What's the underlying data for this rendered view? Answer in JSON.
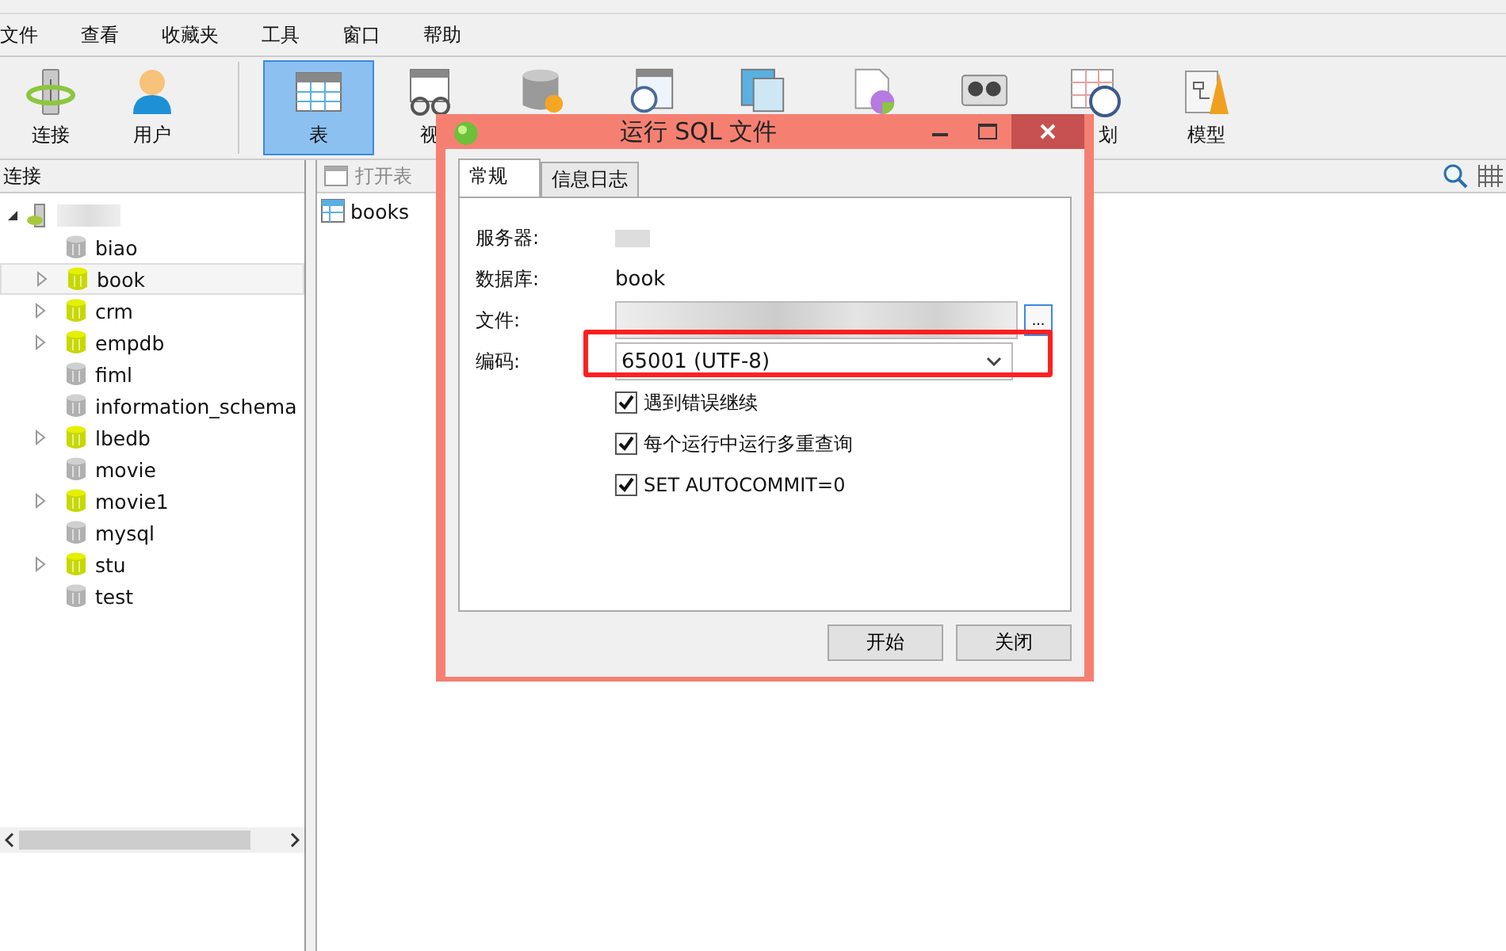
{
  "menu": [
    "文件",
    "查看",
    "收藏夹",
    "工具",
    "窗口",
    "帮助"
  ],
  "toolbar": {
    "left": [
      {
        "kind": "connect",
        "label": "连接",
        "selected": false
      },
      {
        "kind": "user",
        "label": "用户",
        "selected": false
      }
    ],
    "right": [
      {
        "kind": "table",
        "label": "表",
        "selected": true
      },
      {
        "kind": "view",
        "label": "视",
        "selected": false
      },
      {
        "kind": "function",
        "selected": false
      },
      {
        "kind": "event",
        "selected": false
      },
      {
        "kind": "query",
        "selected": false
      },
      {
        "kind": "report",
        "selected": false
      },
      {
        "kind": "backup",
        "selected": false
      },
      {
        "kind": "schedule",
        "label": "划",
        "selected": false
      },
      {
        "kind": "model",
        "label": "模型",
        "selected": false
      }
    ]
  },
  "connections": {
    "header": "连接",
    "root": {
      "expanded": true,
      "children": [
        {
          "name": "biao",
          "open": false,
          "expandable": false,
          "selected": false
        },
        {
          "name": "book",
          "open": true,
          "expandable": true,
          "selected": true
        },
        {
          "name": "crm",
          "open": true,
          "expandable": true,
          "selected": false
        },
        {
          "name": "empdb",
          "open": true,
          "expandable": true,
          "selected": false
        },
        {
          "name": "fiml",
          "open": false,
          "expandable": false,
          "selected": false
        },
        {
          "name": "information_schema",
          "open": false,
          "expandable": false,
          "selected": false
        },
        {
          "name": "lbedb",
          "open": true,
          "expandable": true,
          "selected": false
        },
        {
          "name": "movie",
          "open": false,
          "expandable": false,
          "selected": false
        },
        {
          "name": "movie1",
          "open": true,
          "expandable": true,
          "selected": false
        },
        {
          "name": "mysql",
          "open": false,
          "expandable": false,
          "selected": false
        },
        {
          "name": "stu",
          "open": true,
          "expandable": true,
          "selected": false
        },
        {
          "name": "test",
          "open": false,
          "expandable": false,
          "selected": false
        }
      ]
    }
  },
  "objects": {
    "open_table": "打开表",
    "items": [
      "books"
    ]
  },
  "dialog": {
    "title": "运行 SQL 文件",
    "tabs": [
      {
        "label": "常规",
        "selected": true
      },
      {
        "label": "信息日志",
        "selected": false
      }
    ],
    "server_label": "服务器:",
    "database_label": "数据库:",
    "database": "book",
    "file_label": "文件:",
    "browse": "...",
    "encoding_label": "编码:",
    "encoding": "65001 (UTF-8)",
    "options": [
      {
        "label": "遇到错误继续",
        "checked": true
      },
      {
        "label": "每个运行中运行多重查询",
        "checked": true
      },
      {
        "label": "SET AUTOCOMMIT=0",
        "checked": true
      }
    ],
    "buttons": [
      "开始",
      "关闭"
    ]
  }
}
